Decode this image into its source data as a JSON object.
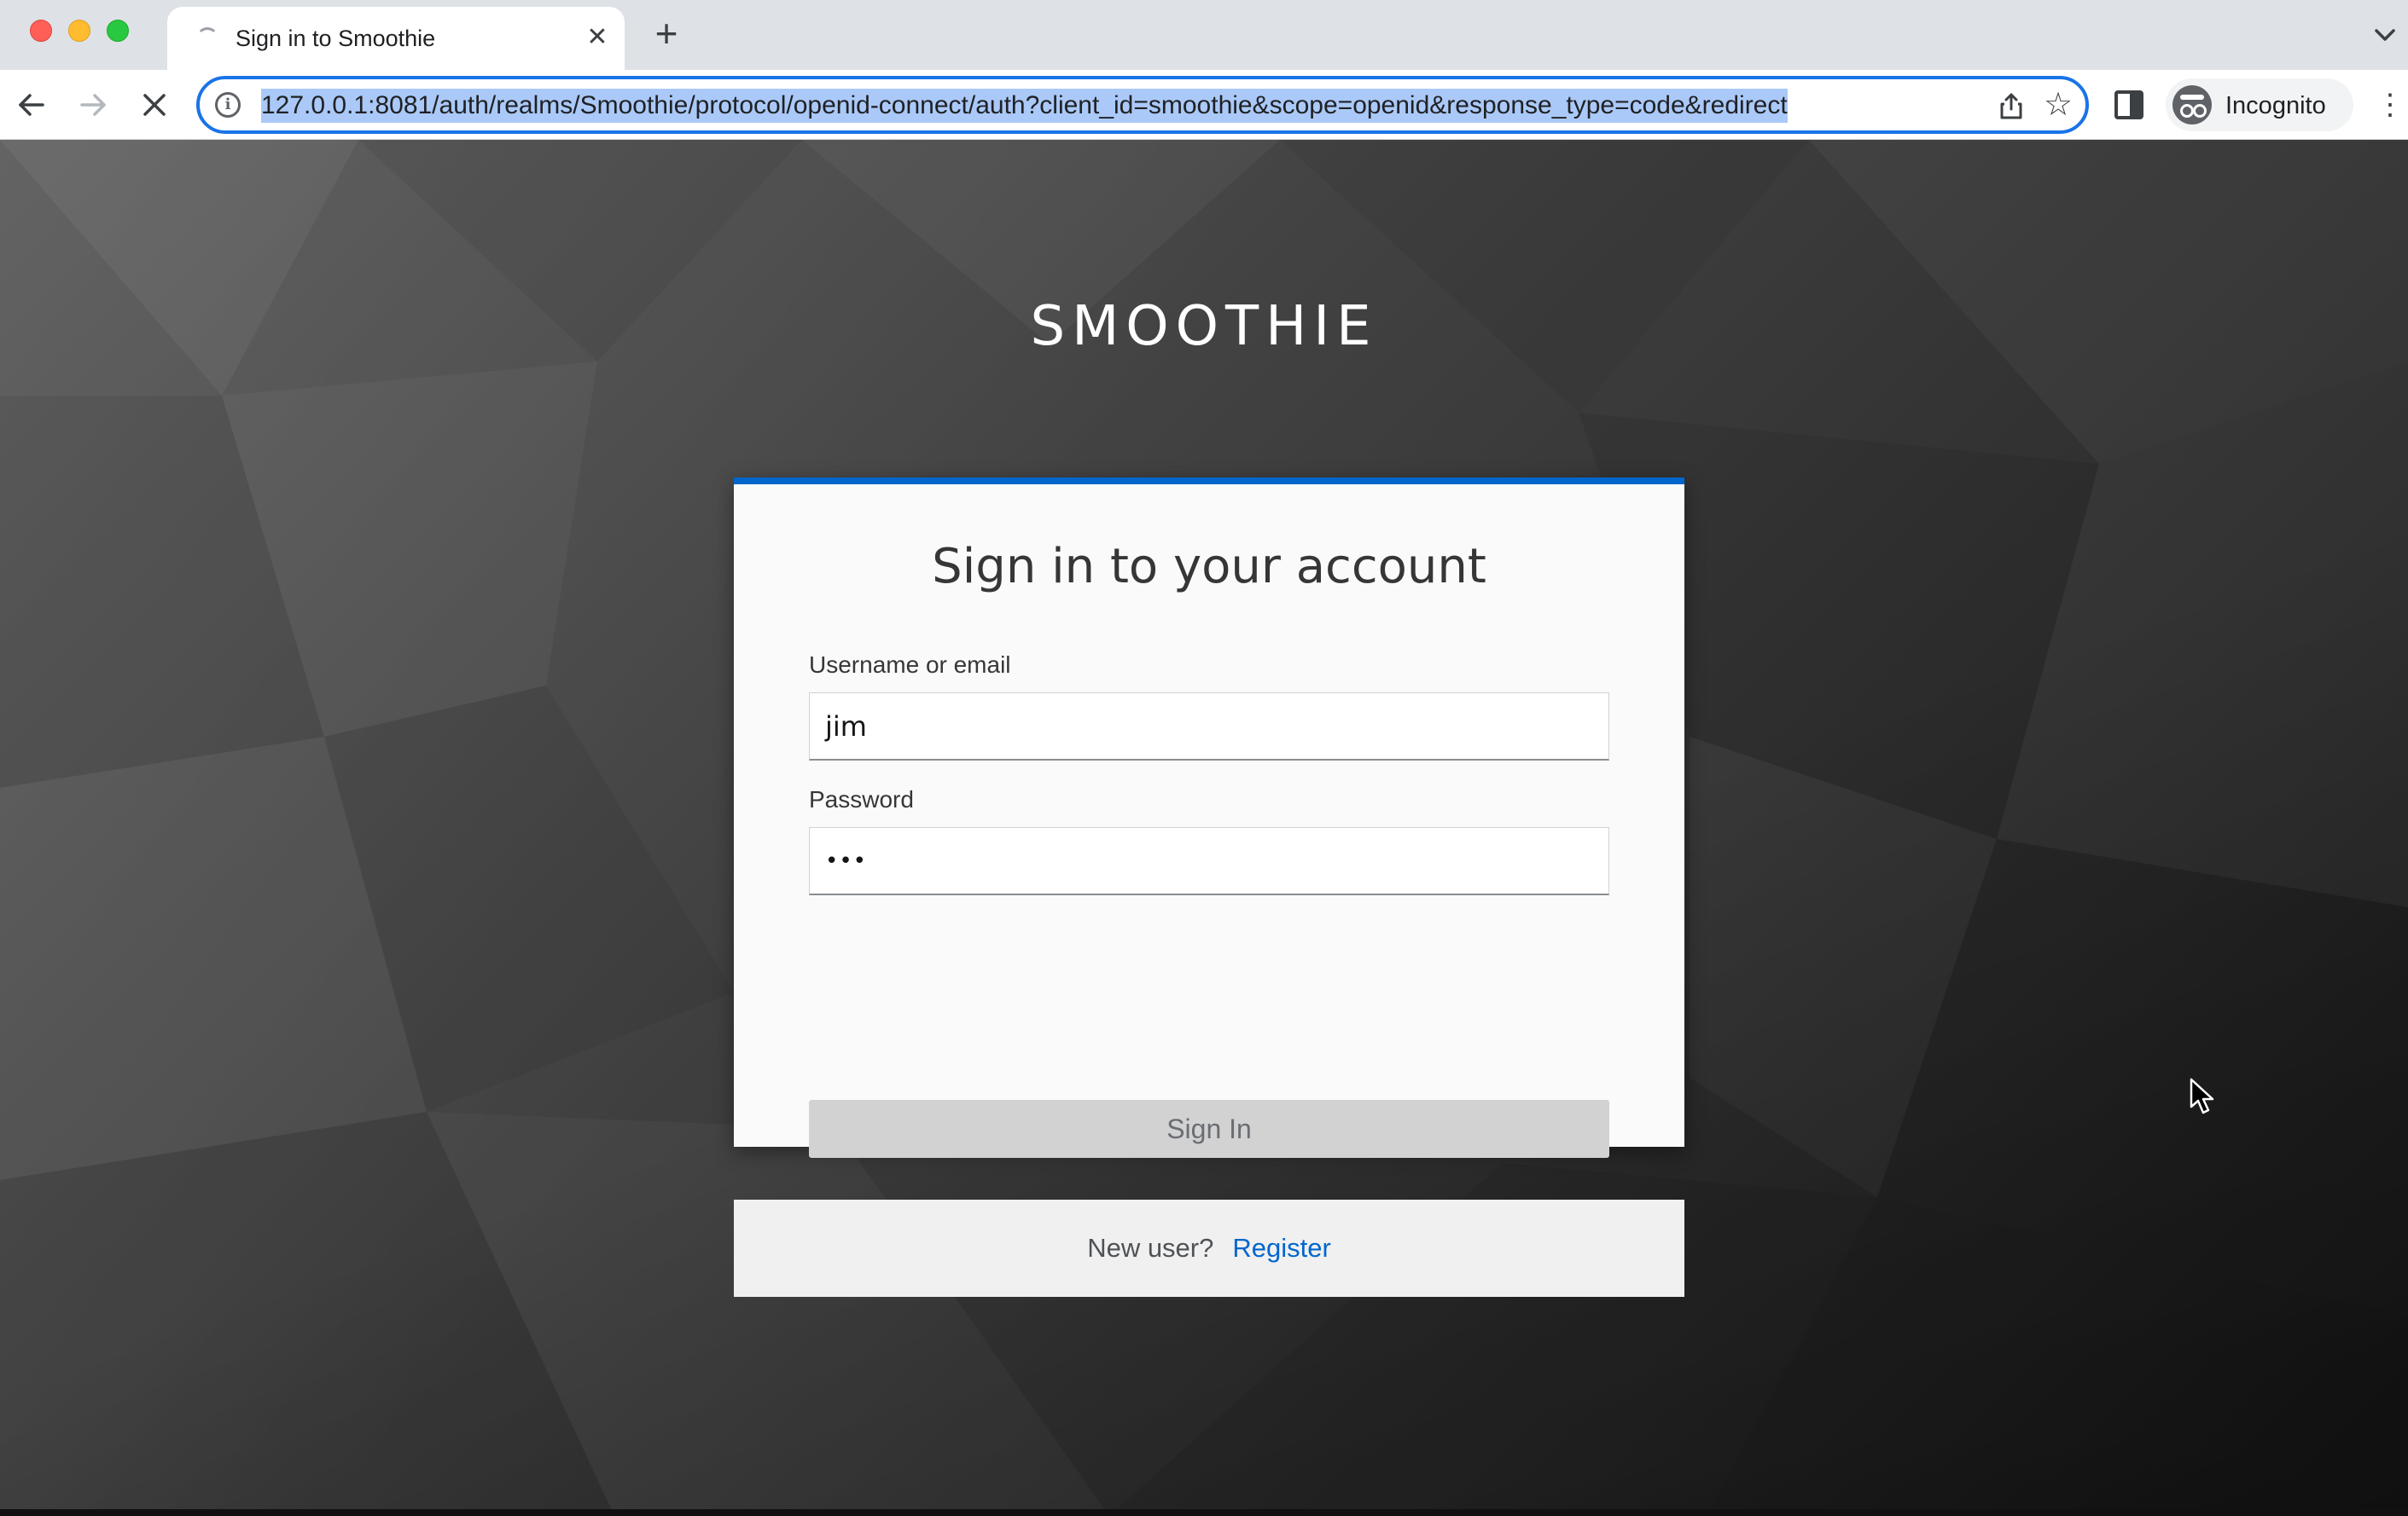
{
  "browser": {
    "tab_title": "Sign in to Smoothie",
    "tab_close_glyph": "✕",
    "new_tab_glyph": "+",
    "url": "127.0.0.1:8081/auth/realms/Smoothie/protocol/openid-connect/auth?client_id=smoothie&scope=openid&response_type=code&redirect",
    "info_glyph": "i",
    "star_glyph": "☆",
    "menu_glyph": "⋮",
    "profile_label": "Incognito",
    "accent_color": "#1a73e8",
    "icons": [
      "back-icon",
      "forward-icon",
      "stop-icon",
      "info-icon",
      "share-icon",
      "star-icon",
      "side-panel-icon",
      "incognito-icon",
      "kebab-menu-icon"
    ]
  },
  "page": {
    "brand": "SMOOTHIE",
    "card": {
      "title": "Sign in to your account",
      "username_label": "Username or email",
      "username_value": "jim",
      "password_label": "Password",
      "password_value": "•••",
      "submit_label": "Sign In",
      "footer_prompt": "New user?",
      "register_link": "Register",
      "accent_color": "#0066cc"
    }
  }
}
